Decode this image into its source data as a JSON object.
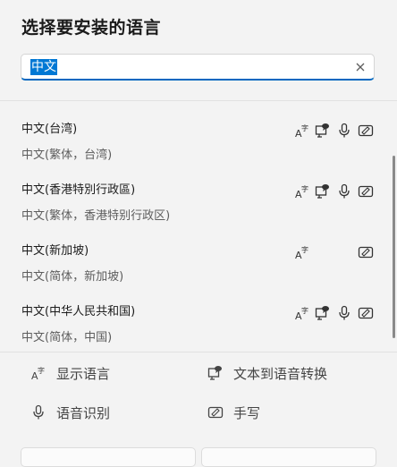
{
  "title": "选择要安装的语言",
  "search": {
    "value": "中文"
  },
  "languages": [
    {
      "name": "中文(台湾)",
      "native": "中文(繁体，台湾)",
      "features": [
        "display-language-icon",
        "text-to-speech-icon",
        "speech-recognition-icon",
        "handwriting-icon"
      ]
    },
    {
      "name": "中文(香港特別行政區)",
      "native": "中文(繁体，香港特别行政区)",
      "features": [
        "display-language-icon",
        "text-to-speech-icon",
        "speech-recognition-icon",
        "handwriting-icon"
      ]
    },
    {
      "name": "中文(新加坡)",
      "native": "中文(简体，新加坡)",
      "features": [
        "display-language-icon",
        "handwriting-icon"
      ]
    },
    {
      "name": "中文(中华人民共和国)",
      "native": "中文(简体，中国)",
      "features": [
        "display-language-icon",
        "text-to-speech-icon",
        "speech-recognition-icon",
        "handwriting-icon"
      ]
    }
  ],
  "legend": {
    "display_language": "显示语言",
    "text_to_speech": "文本到语音转换",
    "speech_recognition": "语音识别",
    "handwriting": "手写"
  },
  "colors": {
    "accent": "#0067c0",
    "selection": "#0078d4"
  }
}
